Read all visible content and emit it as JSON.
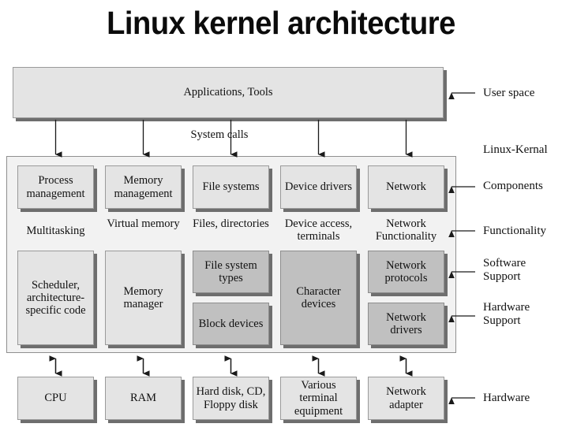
{
  "title": "Linux kernel architecture",
  "user_space": {
    "box_label": "Applications, Tools",
    "side_label": "User space"
  },
  "system_calls_label": "System calls",
  "kernel": {
    "panel_label": "Linux-Kernal",
    "side_labels": {
      "components": "Components",
      "functionality": "Functionality",
      "software_support": "Software Support",
      "hardware_support": "Hardware Support"
    },
    "components": [
      "Process management",
      "Memory management",
      "File systems",
      "Device drivers",
      "Network"
    ],
    "functionality": [
      "Multitasking",
      "Virtual memory",
      "Files, directories",
      "Device access, terminals",
      "Network Functionality"
    ],
    "support": [
      {
        "software": "Scheduler, architecture-specific code",
        "hardware": "",
        "span": true,
        "shade": "light"
      },
      {
        "software": "Memory manager",
        "hardware": "",
        "span": true,
        "shade": "light"
      },
      {
        "software": "File system types",
        "hardware": "Block devices",
        "span": false,
        "shade": "dark"
      },
      {
        "software": "Character devices",
        "hardware": "",
        "span": true,
        "shade": "dark"
      },
      {
        "software": "Network protocols",
        "hardware": "Network drivers",
        "span": false,
        "shade": "dark"
      }
    ]
  },
  "hardware": {
    "side_label": "Hardware",
    "items": [
      "CPU",
      "RAM",
      "Hard disk, CD, Floppy disk",
      "Various terminal equipment",
      "Network adapter"
    ]
  },
  "colors": {
    "box_light": "#e4e4e4",
    "box_dark": "#c0c0c0",
    "panel_bg": "#f2f2f2",
    "shadow": "#6e6e6e",
    "border": "#9a9a9a",
    "text": "#111111",
    "background": "#ffffff"
  }
}
